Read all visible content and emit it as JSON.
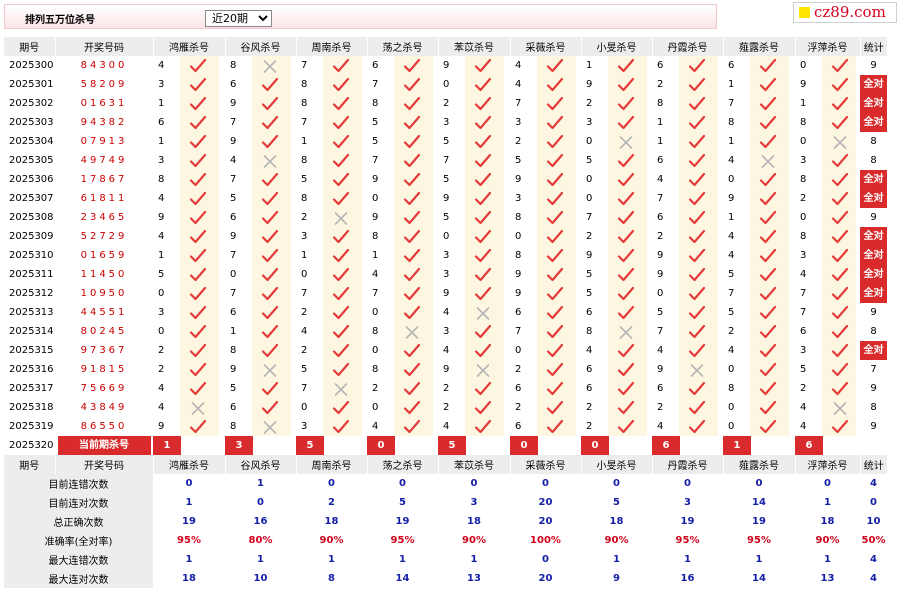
{
  "header": {
    "title": "排列五万位杀号",
    "period_selected": "近20期",
    "period_options": [
      "近20期"
    ],
    "logo_text": "cz89.com"
  },
  "columns": {
    "period": "期号",
    "draw": "开奖号码",
    "experts": [
      "鸿雁杀号",
      "谷风杀号",
      "周南杀号",
      "荡之杀号",
      "苯苡杀号",
      "采薇杀号",
      "小旻杀号",
      "丹霞杀号",
      "薤露杀号",
      "浮萍杀号"
    ],
    "stat": "统计"
  },
  "rows": [
    {
      "period": "2025300",
      "draw": "84300",
      "vals": [
        "4",
        "8",
        "7",
        "6",
        "9",
        "4",
        "1",
        "6",
        "6",
        "0"
      ],
      "ok": [
        1,
        0,
        1,
        1,
        1,
        1,
        1,
        1,
        1,
        1
      ],
      "stat": "9"
    },
    {
      "period": "2025301",
      "draw": "58209",
      "vals": [
        "3",
        "6",
        "8",
        "7",
        "0",
        "4",
        "9",
        "2",
        "1",
        "9"
      ],
      "ok": [
        1,
        1,
        1,
        1,
        1,
        1,
        1,
        1,
        1,
        1
      ],
      "stat": "全对"
    },
    {
      "period": "2025302",
      "draw": "01631",
      "vals": [
        "1",
        "9",
        "8",
        "8",
        "2",
        "7",
        "2",
        "8",
        "7",
        "1"
      ],
      "ok": [
        1,
        1,
        1,
        1,
        1,
        1,
        1,
        1,
        1,
        1
      ],
      "stat": "全对"
    },
    {
      "period": "2025303",
      "draw": "94382",
      "vals": [
        "6",
        "7",
        "7",
        "5",
        "3",
        "3",
        "3",
        "1",
        "8",
        "8"
      ],
      "ok": [
        1,
        1,
        1,
        1,
        1,
        1,
        1,
        1,
        1,
        1
      ],
      "stat": "全对"
    },
    {
      "period": "2025304",
      "draw": "07913",
      "vals": [
        "1",
        "9",
        "1",
        "5",
        "5",
        "2",
        "0",
        "1",
        "1",
        "0"
      ],
      "ok": [
        1,
        1,
        1,
        1,
        1,
        1,
        0,
        1,
        1,
        0
      ],
      "stat": "8"
    },
    {
      "period": "2025305",
      "draw": "49749",
      "vals": [
        "3",
        "4",
        "8",
        "7",
        "7",
        "5",
        "5",
        "6",
        "4",
        "3"
      ],
      "ok": [
        1,
        0,
        1,
        1,
        1,
        1,
        1,
        1,
        0,
        1
      ],
      "stat": "8"
    },
    {
      "period": "2025306",
      "draw": "17867",
      "vals": [
        "8",
        "7",
        "5",
        "9",
        "5",
        "9",
        "0",
        "4",
        "0",
        "8"
      ],
      "ok": [
        1,
        1,
        1,
        1,
        1,
        1,
        1,
        1,
        1,
        1
      ],
      "stat": "全对"
    },
    {
      "period": "2025307",
      "draw": "61811",
      "vals": [
        "4",
        "5",
        "8",
        "0",
        "9",
        "3",
        "0",
        "7",
        "9",
        "2"
      ],
      "ok": [
        1,
        1,
        1,
        1,
        1,
        1,
        1,
        1,
        1,
        1
      ],
      "stat": "全对"
    },
    {
      "period": "2025308",
      "draw": "23465",
      "vals": [
        "9",
        "6",
        "2",
        "9",
        "5",
        "8",
        "7",
        "6",
        "1",
        "0"
      ],
      "ok": [
        1,
        1,
        0,
        1,
        1,
        1,
        1,
        1,
        1,
        1
      ],
      "stat": "9"
    },
    {
      "period": "2025309",
      "draw": "52729",
      "vals": [
        "4",
        "9",
        "3",
        "8",
        "0",
        "0",
        "2",
        "2",
        "4",
        "8"
      ],
      "ok": [
        1,
        1,
        1,
        1,
        1,
        1,
        1,
        1,
        1,
        1
      ],
      "stat": "全对"
    },
    {
      "period": "2025310",
      "draw": "01659",
      "vals": [
        "1",
        "7",
        "1",
        "1",
        "3",
        "8",
        "9",
        "9",
        "4",
        "3"
      ],
      "ok": [
        1,
        1,
        1,
        1,
        1,
        1,
        1,
        1,
        1,
        1
      ],
      "stat": "全对"
    },
    {
      "period": "2025311",
      "draw": "11450",
      "vals": [
        "5",
        "0",
        "0",
        "4",
        "3",
        "9",
        "5",
        "9",
        "5",
        "4"
      ],
      "ok": [
        1,
        1,
        1,
        1,
        1,
        1,
        1,
        1,
        1,
        1
      ],
      "stat": "全对"
    },
    {
      "period": "2025312",
      "draw": "10950",
      "vals": [
        "0",
        "7",
        "7",
        "7",
        "9",
        "9",
        "5",
        "0",
        "7",
        "7"
      ],
      "ok": [
        1,
        1,
        1,
        1,
        1,
        1,
        1,
        1,
        1,
        1
      ],
      "stat": "全对"
    },
    {
      "period": "2025313",
      "draw": "44551",
      "vals": [
        "3",
        "6",
        "2",
        "0",
        "4",
        "6",
        "6",
        "5",
        "5",
        "7"
      ],
      "ok": [
        1,
        1,
        1,
        1,
        0,
        1,
        1,
        1,
        1,
        1
      ],
      "stat": "9"
    },
    {
      "period": "2025314",
      "draw": "80245",
      "vals": [
        "0",
        "1",
        "4",
        "8",
        "3",
        "7",
        "8",
        "7",
        "2",
        "6"
      ],
      "ok": [
        1,
        1,
        1,
        0,
        1,
        1,
        0,
        1,
        1,
        1
      ],
      "stat": "8"
    },
    {
      "period": "2025315",
      "draw": "97367",
      "vals": [
        "2",
        "8",
        "2",
        "0",
        "4",
        "0",
        "4",
        "4",
        "4",
        "3"
      ],
      "ok": [
        1,
        1,
        1,
        1,
        1,
        1,
        1,
        1,
        1,
        1
      ],
      "stat": "全对"
    },
    {
      "period": "2025316",
      "draw": "91815",
      "vals": [
        "2",
        "9",
        "5",
        "8",
        "9",
        "2",
        "6",
        "9",
        "0",
        "5"
      ],
      "ok": [
        1,
        0,
        1,
        1,
        0,
        1,
        1,
        0,
        1,
        1
      ],
      "stat": "7"
    },
    {
      "period": "2025317",
      "draw": "75669",
      "vals": [
        "4",
        "5",
        "7",
        "2",
        "2",
        "6",
        "6",
        "6",
        "8",
        "2"
      ],
      "ok": [
        1,
        1,
        0,
        1,
        1,
        1,
        1,
        1,
        1,
        1
      ],
      "stat": "9"
    },
    {
      "period": "2025318",
      "draw": "43849",
      "vals": [
        "4",
        "6",
        "0",
        "0",
        "2",
        "2",
        "2",
        "2",
        "0",
        "4"
      ],
      "ok": [
        0,
        1,
        1,
        1,
        1,
        1,
        1,
        1,
        1,
        0
      ],
      "stat": "8"
    },
    {
      "period": "2025319",
      "draw": "86550",
      "vals": [
        "9",
        "8",
        "3",
        "4",
        "4",
        "6",
        "2",
        "4",
        "0",
        "4"
      ],
      "ok": [
        1,
        0,
        1,
        1,
        1,
        1,
        1,
        1,
        1,
        1
      ],
      "stat": "9"
    }
  ],
  "current": {
    "period": "2025320",
    "label": "当前期杀号",
    "vals": [
      "1",
      "3",
      "5",
      "0",
      "5",
      "0",
      "0",
      "6",
      "1",
      "6"
    ]
  },
  "summary": [
    {
      "label": "目前连错次数",
      "vals": [
        "0",
        "1",
        "0",
        "0",
        "0",
        "0",
        "0",
        "0",
        "0",
        "0"
      ],
      "stat": "4",
      "red": false
    },
    {
      "label": "目前连对次数",
      "vals": [
        "1",
        "0",
        "2",
        "5",
        "3",
        "20",
        "5",
        "3",
        "14",
        "1"
      ],
      "stat": "0",
      "red": false
    },
    {
      "label": "总正确次数",
      "vals": [
        "19",
        "16",
        "18",
        "19",
        "18",
        "20",
        "18",
        "19",
        "19",
        "18"
      ],
      "stat": "10",
      "red": false
    },
    {
      "label": "准确率(全对率)",
      "vals": [
        "95%",
        "80%",
        "90%",
        "95%",
        "90%",
        "100%",
        "90%",
        "95%",
        "95%",
        "90%"
      ],
      "stat": "50%",
      "red": true
    },
    {
      "label": "最大连错次数",
      "vals": [
        "1",
        "1",
        "1",
        "1",
        "1",
        "0",
        "1",
        "1",
        "1",
        "1"
      ],
      "stat": "4",
      "red": false
    },
    {
      "label": "最大连对次数",
      "vals": [
        "18",
        "10",
        "8",
        "14",
        "13",
        "20",
        "9",
        "16",
        "14",
        "13"
      ],
      "stat": "4",
      "red": false
    }
  ],
  "colors": {
    "accent": "#d92b2b",
    "draw": "#cc0000",
    "summary": "#1520a6",
    "header_bg": "#ededed",
    "mark_bg": "#fdf7e2"
  }
}
